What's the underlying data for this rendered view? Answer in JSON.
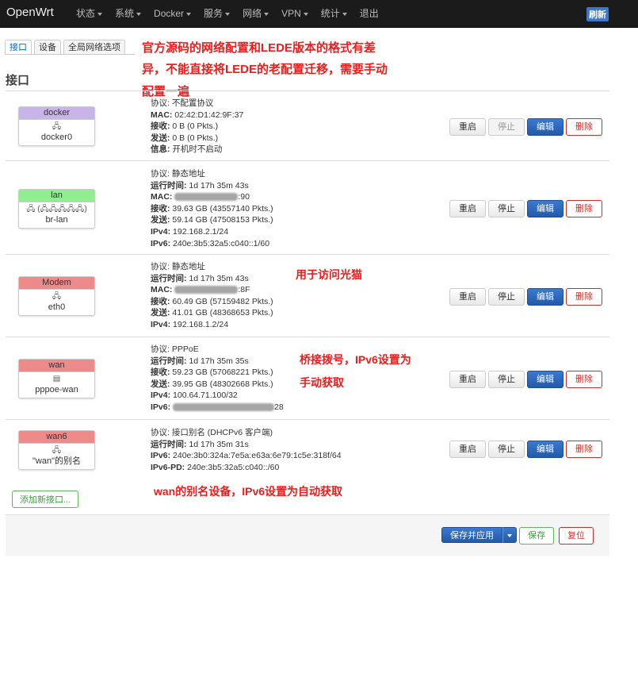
{
  "nav": {
    "brand": "OpenWrt",
    "menu": [
      "状态",
      "系统",
      "Docker",
      "服务",
      "网络",
      "VPN",
      "统计",
      "退出"
    ],
    "refresh": "刷新"
  },
  "tabs": [
    "接口",
    "设备",
    "全局网络选项"
  ],
  "section_title": "接口",
  "annotations": {
    "top_line1": "官方源码的网络配置和LEDE版本的格式有差",
    "top_line2": "异，不能直接将LEDE的老配置迁移，需要手动",
    "top_line3": "配置一遍",
    "modem": "用于访问光猫",
    "wan_line1": "桥接拨号，IPv6设置为",
    "wan_line2": "手动获取",
    "wan6": "wan的别名设备，IPv6设置为自动获取"
  },
  "buttons": {
    "restart": "重启",
    "stop": "停止",
    "edit": "编辑",
    "delete": "删除"
  },
  "interfaces": [
    {
      "name": "docker",
      "color": "#c8b4e8",
      "icons": "🖧",
      "device": "docker0",
      "lines": [
        {
          "label": "协议:",
          "value": " 不配置协议",
          "bold": false
        },
        {
          "label": "MAC:",
          "value": " 02:42:D1:42:9F:37",
          "bold": true
        },
        {
          "label": "接收:",
          "value": " 0 B (0 Pkts.)",
          "bold": true
        },
        {
          "label": "发送:",
          "value": " 0 B (0 Pkts.)",
          "bold": true
        },
        {
          "label": "信息:",
          "value": " 开机时不启动",
          "bold": true
        }
      ]
    },
    {
      "name": "lan",
      "color": "#90ee90",
      "icons": "🖧 (🖧🖧🖧🖧🖧)",
      "device": "br-lan",
      "lines": [
        {
          "label": "协议:",
          "value": " 静态地址",
          "bold": false
        },
        {
          "label": "运行时间:",
          "value": " 1d 17h 35m 43s",
          "bold": true
        },
        {
          "label": "MAC:",
          "value": " ██████████:90",
          "bold": true
        },
        {
          "label": "接收:",
          "value": " 39.63 GB (43557140 Pkts.)",
          "bold": true
        },
        {
          "label": "发送:",
          "value": " 59.14 GB (47508153 Pkts.)",
          "bold": true
        },
        {
          "label": "IPv4:",
          "value": " 192.168.2.1/24",
          "bold": true
        },
        {
          "label": "IPv6:",
          "value": " 240e:3b5:32a5:c040::1/60",
          "bold": true
        }
      ]
    },
    {
      "name": "Modem",
      "color": "#ee8a8a",
      "icons": "🖧",
      "device": "eth0",
      "lines": [
        {
          "label": "协议:",
          "value": " 静态地址",
          "bold": false
        },
        {
          "label": "运行时间:",
          "value": " 1d 17h 35m 43s",
          "bold": true
        },
        {
          "label": "MAC:",
          "value": " ██████████:8F",
          "bold": true
        },
        {
          "label": "接收:",
          "value": " 60.49 GB (57159482 Pkts.)",
          "bold": true
        },
        {
          "label": "发送:",
          "value": " 41.01 GB (48368653 Pkts.)",
          "bold": true
        },
        {
          "label": "IPv4:",
          "value": " 192.168.1.2/24",
          "bold": true
        }
      ]
    },
    {
      "name": "wan",
      "color": "#ee8a8a",
      "icons": "▤",
      "device": "pppoe-wan",
      "lines": [
        {
          "label": "协议:",
          "value": " PPPoE",
          "bold": false
        },
        {
          "label": "运行时间:",
          "value": " 1d 17h 35m 35s",
          "bold": true
        },
        {
          "label": "接收:",
          "value": " 59.23 GB (57068221 Pkts.)",
          "bold": true
        },
        {
          "label": "发送:",
          "value": " 39.95 GB (48302668 Pkts.)",
          "bold": true
        },
        {
          "label": "IPv4:",
          "value": " 100.64.71.100/32",
          "bold": true
        },
        {
          "label": "IPv6:",
          "value": " ████████████████28",
          "bold": true
        }
      ]
    },
    {
      "name": "wan6",
      "color": "#ee8a8a",
      "icons": "🖧",
      "device": "\"wan\"的别名",
      "lines": [
        {
          "label": "协议:",
          "value": " 接口别名 (DHCPv6 客户端)",
          "bold": false
        },
        {
          "label": "运行时间:",
          "value": " 1d 17h 35m 31s",
          "bold": true
        },
        {
          "label": "IPv6:",
          "value": " 240e:3b0:324a:7e5a:e63a:6e79:1c5e:318f/64",
          "bold": true
        },
        {
          "label": "IPv6-PD:",
          "value": " 240e:3b5:32a5:c040::/60",
          "bold": true
        }
      ]
    }
  ],
  "add_interface": "添加新接口...",
  "footer": {
    "save_apply": "保存并应用",
    "save": "保存",
    "reset": "复位"
  }
}
